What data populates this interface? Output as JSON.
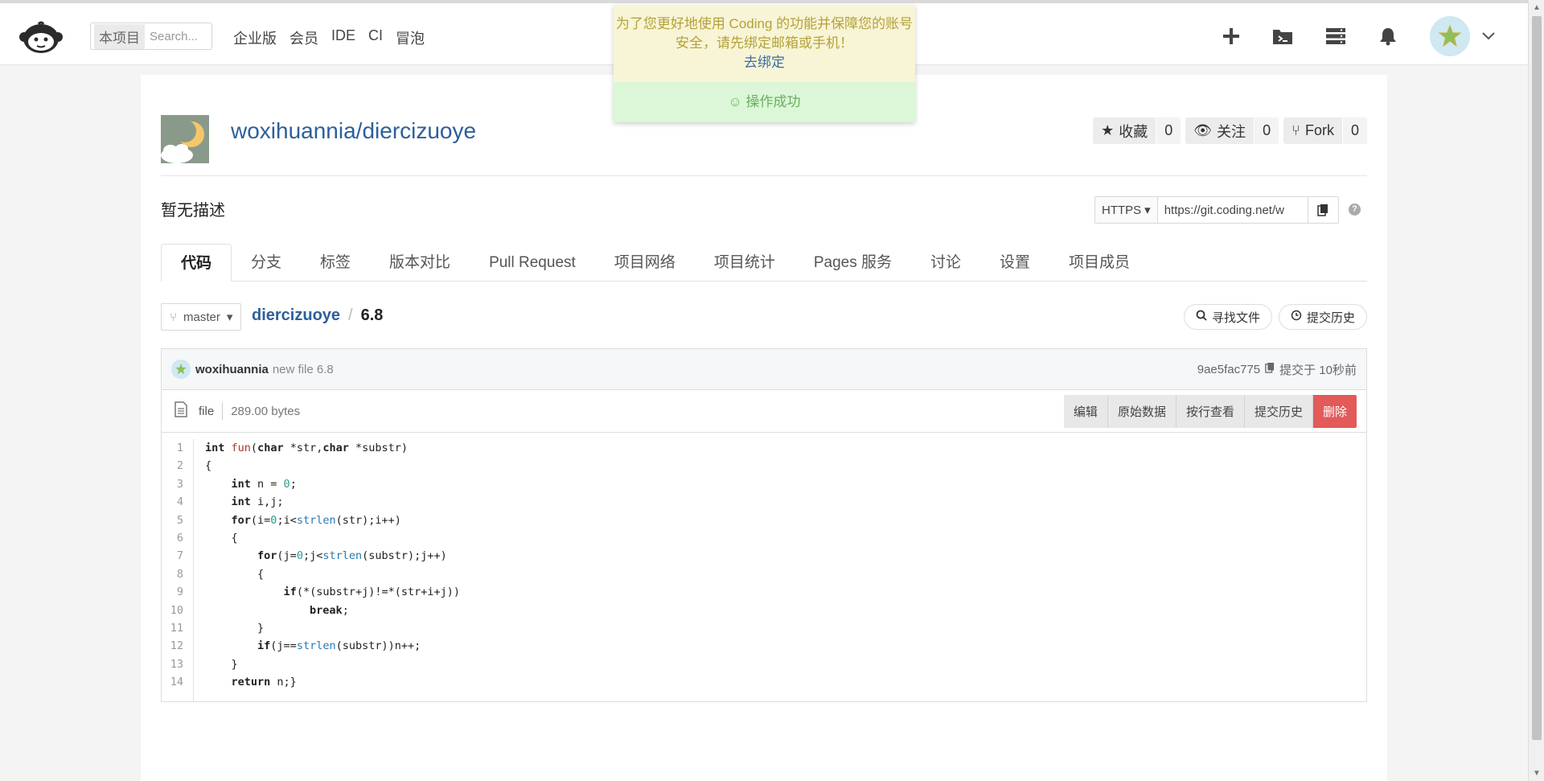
{
  "nav": {
    "search_scope": "本项目",
    "search_placeholder": "Search...",
    "links": [
      "企业版",
      "会员",
      "IDE",
      "CI",
      "冒泡"
    ]
  },
  "toast": {
    "warning_text": "为了您更好地使用 Coding 的功能并保障您的账号安全，请先绑定邮箱或手机！",
    "bind_link": "去绑定",
    "success_text": "操作成功"
  },
  "project": {
    "title": "woxihuannia/diercizuoye",
    "description": "暂无描述",
    "stats": [
      {
        "label": "收藏",
        "count": "0",
        "icon": "star-icon"
      },
      {
        "label": "关注",
        "count": "0",
        "icon": "eye-icon"
      },
      {
        "label": "Fork",
        "count": "0",
        "icon": "fork-icon"
      }
    ],
    "clone": {
      "protocol": "HTTPS",
      "url": "https://git.coding.net/w"
    }
  },
  "tabs": [
    "代码",
    "分支",
    "标签",
    "版本对比",
    "Pull Request",
    "项目网络",
    "项目统计",
    "Pages 服务",
    "讨论",
    "设置",
    "项目成员"
  ],
  "file_nav": {
    "branch": "master",
    "repo": "diercizuoye",
    "separator": "/",
    "file": "6.8",
    "find_file": "寻找文件",
    "history": "提交历史"
  },
  "commit": {
    "user": "woxihuannia",
    "message": "new file 6.8",
    "hash": "9ae5fac775",
    "time": "提交于 10秒前"
  },
  "file_info": {
    "type": "file",
    "size": "289.00 bytes",
    "buttons": [
      "编辑",
      "原始数据",
      "按行查看",
      "提交历史",
      "删除"
    ]
  },
  "code_lines": [
    "int fun(char *str,char *substr)",
    "{",
    "    int n = 0;",
    "    int i,j;",
    "    for(i=0;i<strlen(str);i++)",
    "    {",
    "        for(j=0;j<strlen(substr);j++)",
    "        {",
    "            if(*(substr+j)!=*(str+i+j))",
    "                break;",
    "        }",
    "        if(j==strlen(substr))n++;",
    "    }",
    "    return n;}"
  ],
  "colors": {
    "link": "#2d5f9a",
    "danger": "#e25a5a",
    "success": "#6cae5f",
    "warning": "#b3a23a"
  }
}
